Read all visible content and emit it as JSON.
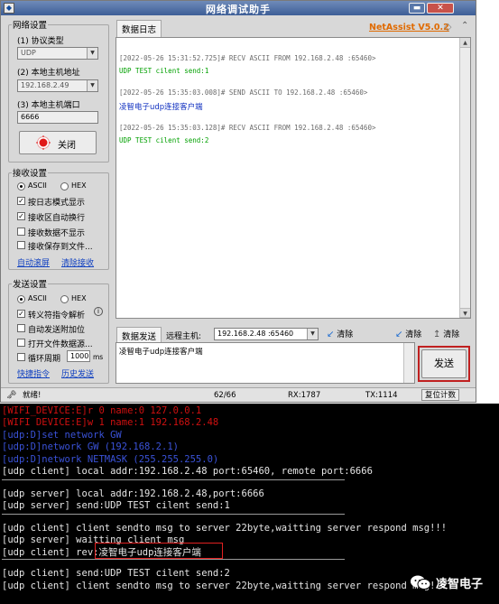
{
  "window": {
    "title": "网络调试助手",
    "version": "NetAssist V5.0.2",
    "icon_name": "app-icon"
  },
  "network": {
    "legend": "网络设置",
    "protocol_label": "(1) 协议类型",
    "protocol_value": "UDP",
    "host_label": "(2) 本地主机地址",
    "host_value": "192.168.2.49",
    "port_label": "(3) 本地主机端口",
    "port_value": "6666",
    "close_label": "关闭"
  },
  "recv": {
    "legend": "接收设置",
    "ascii": "ASCII",
    "hex": "HEX",
    "opt1": "按日志模式显示",
    "opt2": "接收区自动换行",
    "opt3": "接收数据不显示",
    "opt4": "接收保存到文件...",
    "link1": "自动滚屏",
    "link2": "清除接收"
  },
  "send": {
    "legend": "发送设置",
    "ascii": "ASCII",
    "hex": "HEX",
    "opt1": "转义符指令解析",
    "opt1_info": "i",
    "opt2": "自动发送附加位",
    "opt3": "打开文件数据源...",
    "opt4": "循环周期",
    "period": "1000",
    "unit": "ms",
    "link1": "快捷指令",
    "link2": "历史发送"
  },
  "log": {
    "tab": "数据日志",
    "entries": [
      {
        "header": "[2022-05-26 15:31:52.725]# RECV ASCII FROM 192.168.2.48 :65460>",
        "body": "UDP TEST cilent send:1",
        "body_color": "#00a000"
      },
      {
        "header": "[2022-05-26 15:35:03.008]# SEND ASCII TO 192.168.2.48 :65460>",
        "body": "凌智电子udp连接客户端",
        "body_color": "#1030c0"
      },
      {
        "header": "[2022-05-26 15:35:03.128]# RECV ASCII FROM 192.168.2.48 :65460>",
        "body": "UDP TEST cilent send:2",
        "body_color": "#00a000"
      }
    ],
    "header_color": "#6a6a6a"
  },
  "sendbar": {
    "tab": "数据发送",
    "remote_label": "远程主机:",
    "remote_value": "192.168.2.48 :65460",
    "clear1": "清除",
    "clear2": "清除",
    "clear3": "清除",
    "text": "凌智电子udp连接客户端",
    "send_btn": "发送"
  },
  "status": {
    "state": "就绪!",
    "count": "62/66",
    "rx": "RX:1787",
    "tx": "TX:1114",
    "reset": "复位计数"
  },
  "console": {
    "lines": [
      {
        "text": "[WIFI_DEVICE:E]r 0 name:0 127.0.0.1",
        "color": "#d01010"
      },
      {
        "text": "[WIFI DEVICE:E]w 1 name:1 192.168.2.48",
        "color": "#d01010"
      },
      {
        "text": "[udp:D]set network GW",
        "color": "#3a52d8"
      },
      {
        "text": "[udp:D]network GW (192.168.2.1)",
        "color": "#3a52d8"
      },
      {
        "text": "[udp:D]network NETMASK (255.255.255.0)",
        "color": "#3a52d8"
      },
      {
        "text": "[udp client] local addr:192.168.2.48 port:65460, remote port:6666",
        "color": "#e6e6e6"
      },
      {
        "text": "[udp server] local addr:192.168.2.48,port:6666",
        "color": "#e6e6e6"
      },
      {
        "text": "[udp server] send:UDP TEST cilent send:1",
        "color": "#e6e6e6"
      },
      {
        "text": "[udp client] client sendto msg to server 22byte,waitting server respond msg!!!",
        "color": "#e6e6e6"
      },
      {
        "text": "[udp server] waitting client msg",
        "color": "#e6e6e6"
      },
      {
        "text": "[udp client] rev:凌智电子udp连接客户端",
        "color": "#e6e6e6"
      },
      {
        "text": "[udp client] send:UDP TEST cilent send:2",
        "color": "#e6e6e6"
      },
      {
        "text": "[udp client] client sendto msg to server 22byte,waitting server respond msg!!!",
        "color": "#e6e6e6"
      }
    ]
  },
  "watermark": {
    "text": "凌智电子",
    "icon_name": "wechat-icon"
  },
  "colors": {
    "accent_version": "#e06a00",
    "send_border": "#c02020",
    "highlight": "#e02020"
  }
}
